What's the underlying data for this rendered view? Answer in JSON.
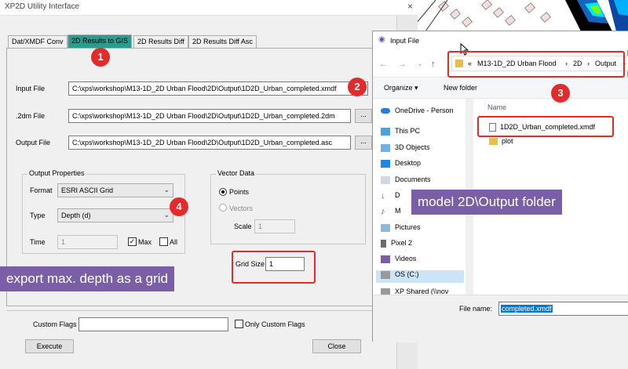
{
  "xp2d": {
    "title": "XP2D Utility Interface",
    "close": "×",
    "tabs": [
      {
        "label": "Dat/XMDF Conv"
      },
      {
        "label": "2D Results to GIS"
      },
      {
        "label": "2D Results Diff"
      },
      {
        "label": "2D Results Diff Asc"
      }
    ],
    "input_file": {
      "label": "Input File",
      "value": "C:\\xps\\workshop\\M13-1D_2D Urban Flood\\2D\\Output\\1D2D_Urban_completed.xmdf"
    },
    "two_dm_file": {
      "label": ".2dm File",
      "value": "C:\\xps\\workshop\\M13-1D_2D Urban Flood\\2D\\Output\\1D2D_Urban_completed.2dm",
      "browse": "..."
    },
    "output_file": {
      "label": "Output File",
      "value": "C:\\xps\\workshop\\M13-1D_2D Urban Flood\\2D\\Output\\1D2D_Urban_completed.asc",
      "browse": "..."
    },
    "output_properties": {
      "title": "Output Properties",
      "format_label": "Format",
      "format_value": "ESRI ASCII Grid",
      "type_label": "Type",
      "type_value": "Depth (d)",
      "time_label": "Time",
      "time_value": "1",
      "max_label": "Max",
      "max_checked": true,
      "all_label": "All",
      "all_checked": false
    },
    "vector_data": {
      "title": "Vector Data",
      "points_label": "Points",
      "vectors_label": "Vectors",
      "scale_label": "Scale",
      "scale_value": "1"
    },
    "grid_size": {
      "label": "Grid Size",
      "value": "1"
    },
    "custom_flags": {
      "label": "Custom Flags",
      "value": "",
      "only_label": "Only Custom Flags"
    },
    "execute_label": "Execute",
    "close_label": "Close"
  },
  "annotations": {
    "badge1": "1",
    "badge2": "2",
    "badge3": "3",
    "badge4": "4",
    "callout_grid": "export max. depth as a grid",
    "callout_folder": "model 2D\\Output folder",
    "color_red": "#e32b2b",
    "color_purple": "#7a5fa8"
  },
  "dialog": {
    "title": "Input File",
    "breadcrumb": [
      "«",
      "M13-1D_2D Urban Flood",
      "›",
      "2D",
      "›",
      "Output",
      "›"
    ],
    "organize_label": "Organize ▾",
    "new_folder_label": "New folder",
    "nav_items": [
      {
        "label": "OneDrive - Person",
        "icon": "cloud-icon"
      },
      {
        "label": "This PC",
        "icon": "computer-icon"
      },
      {
        "label": "3D Objects",
        "icon": "cube-icon"
      },
      {
        "label": "Desktop",
        "icon": "desktop-icon"
      },
      {
        "label": "Documents",
        "icon": "documents-icon"
      },
      {
        "label": "D",
        "icon": "download-icon"
      },
      {
        "label": "M",
        "icon": "music-icon"
      },
      {
        "label": "Pictures",
        "icon": "pictures-icon"
      },
      {
        "label": "Pixel 2",
        "icon": "phone-icon"
      },
      {
        "label": "Videos",
        "icon": "videos-icon"
      },
      {
        "label": "OS (C:)",
        "icon": "drive-icon"
      },
      {
        "label": "XP Shared (\\\\nov",
        "icon": "network-drive-icon"
      }
    ],
    "column_name": "Name",
    "files": [
      {
        "name": "1D2D_Urban_completed.xmdf",
        "icon": "file-icon"
      },
      {
        "name": "plot",
        "icon": "folder-icon"
      }
    ],
    "file_name_label": "File name:",
    "file_name_value": "completed.xmdf"
  }
}
